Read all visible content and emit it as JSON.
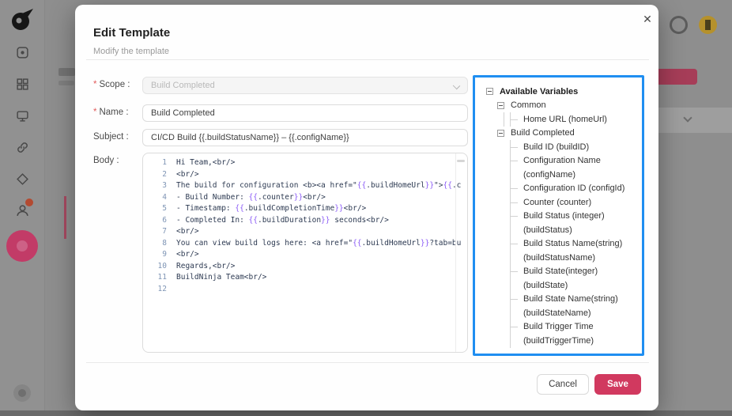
{
  "colors": {
    "accent": "#d1395f",
    "panel_border": "#1f8ef1",
    "overlay": "#8e8e8e"
  },
  "modal": {
    "title": "Edit Template",
    "subtitle": "Modify the template",
    "close_glyph": "✕",
    "form": {
      "scope": {
        "label": "Scope :",
        "required": true,
        "value": "Build Completed",
        "disabled": true
      },
      "name": {
        "label": "Name :",
        "required": true,
        "value": "Build Completed"
      },
      "subject": {
        "label": "Subject :",
        "required": false,
        "value": "CI/CD Build {{.buildStatusName}} – {{.configName}}"
      },
      "body": {
        "label": "Body :",
        "lines": [
          "Hi Team,<br/>",
          "<br/>",
          "The build for configuration <b><a href=\"{{.buildHomeUrl}}\">{{.c",
          "- Build Number: {{.counter}}<br/>",
          "- Timestamp: {{.buildCompletionTime}}<br/>",
          "- Completed In: {{.buildDuration}} seconds<br/>",
          "<br/>",
          "You can view build logs here: <a href=\"{{.buildHomeUrl}}?tab=bu",
          "<br/>",
          "Regards,<br/>",
          "BuildNinja Team<br/>",
          ""
        ]
      }
    },
    "footer": {
      "cancel_label": "Cancel",
      "save_label": "Save"
    }
  },
  "variables_panel": {
    "tree": [
      {
        "type": "group",
        "level": 0,
        "bold": true,
        "label": "Available Variables"
      },
      {
        "type": "group",
        "level": 1,
        "bold": false,
        "label": "Common"
      },
      {
        "type": "leaf",
        "parent_guide": true,
        "lines": [
          "Home URL (homeUrl)"
        ]
      },
      {
        "type": "group",
        "level": 1,
        "bold": false,
        "label": "Build Completed"
      },
      {
        "type": "leaf",
        "lines": [
          "Build ID (buildID)"
        ]
      },
      {
        "type": "leaf",
        "lines": [
          "Configuration Name",
          "(configName)"
        ]
      },
      {
        "type": "leaf",
        "lines": [
          "Configuration ID (configId)"
        ]
      },
      {
        "type": "leaf",
        "lines": [
          "Counter (counter)"
        ]
      },
      {
        "type": "leaf",
        "lines": [
          "Build Status (integer)",
          "(buildStatus)"
        ]
      },
      {
        "type": "leaf",
        "lines": [
          "Build Status Name(string)",
          "(buildStatusName)"
        ]
      },
      {
        "type": "leaf",
        "lines": [
          "Build State(integer)",
          "(buildState)"
        ]
      },
      {
        "type": "leaf",
        "lines": [
          "Build State Name(string)",
          "(buildStateName)"
        ]
      },
      {
        "type": "leaf",
        "lines": [
          "Build Trigger Time",
          "(buildTriggerTime)"
        ]
      }
    ]
  },
  "background": {
    "sidebar_icons": [
      "app-logo",
      "dashboard-icon",
      "grid-icon",
      "monitor-icon",
      "link-icon",
      "pipeline-icon",
      "user-icon",
      "settings-active-icon",
      "bottom-avatar"
    ],
    "topbar_icons": [
      "help-icon",
      "user-avatar"
    ]
  }
}
